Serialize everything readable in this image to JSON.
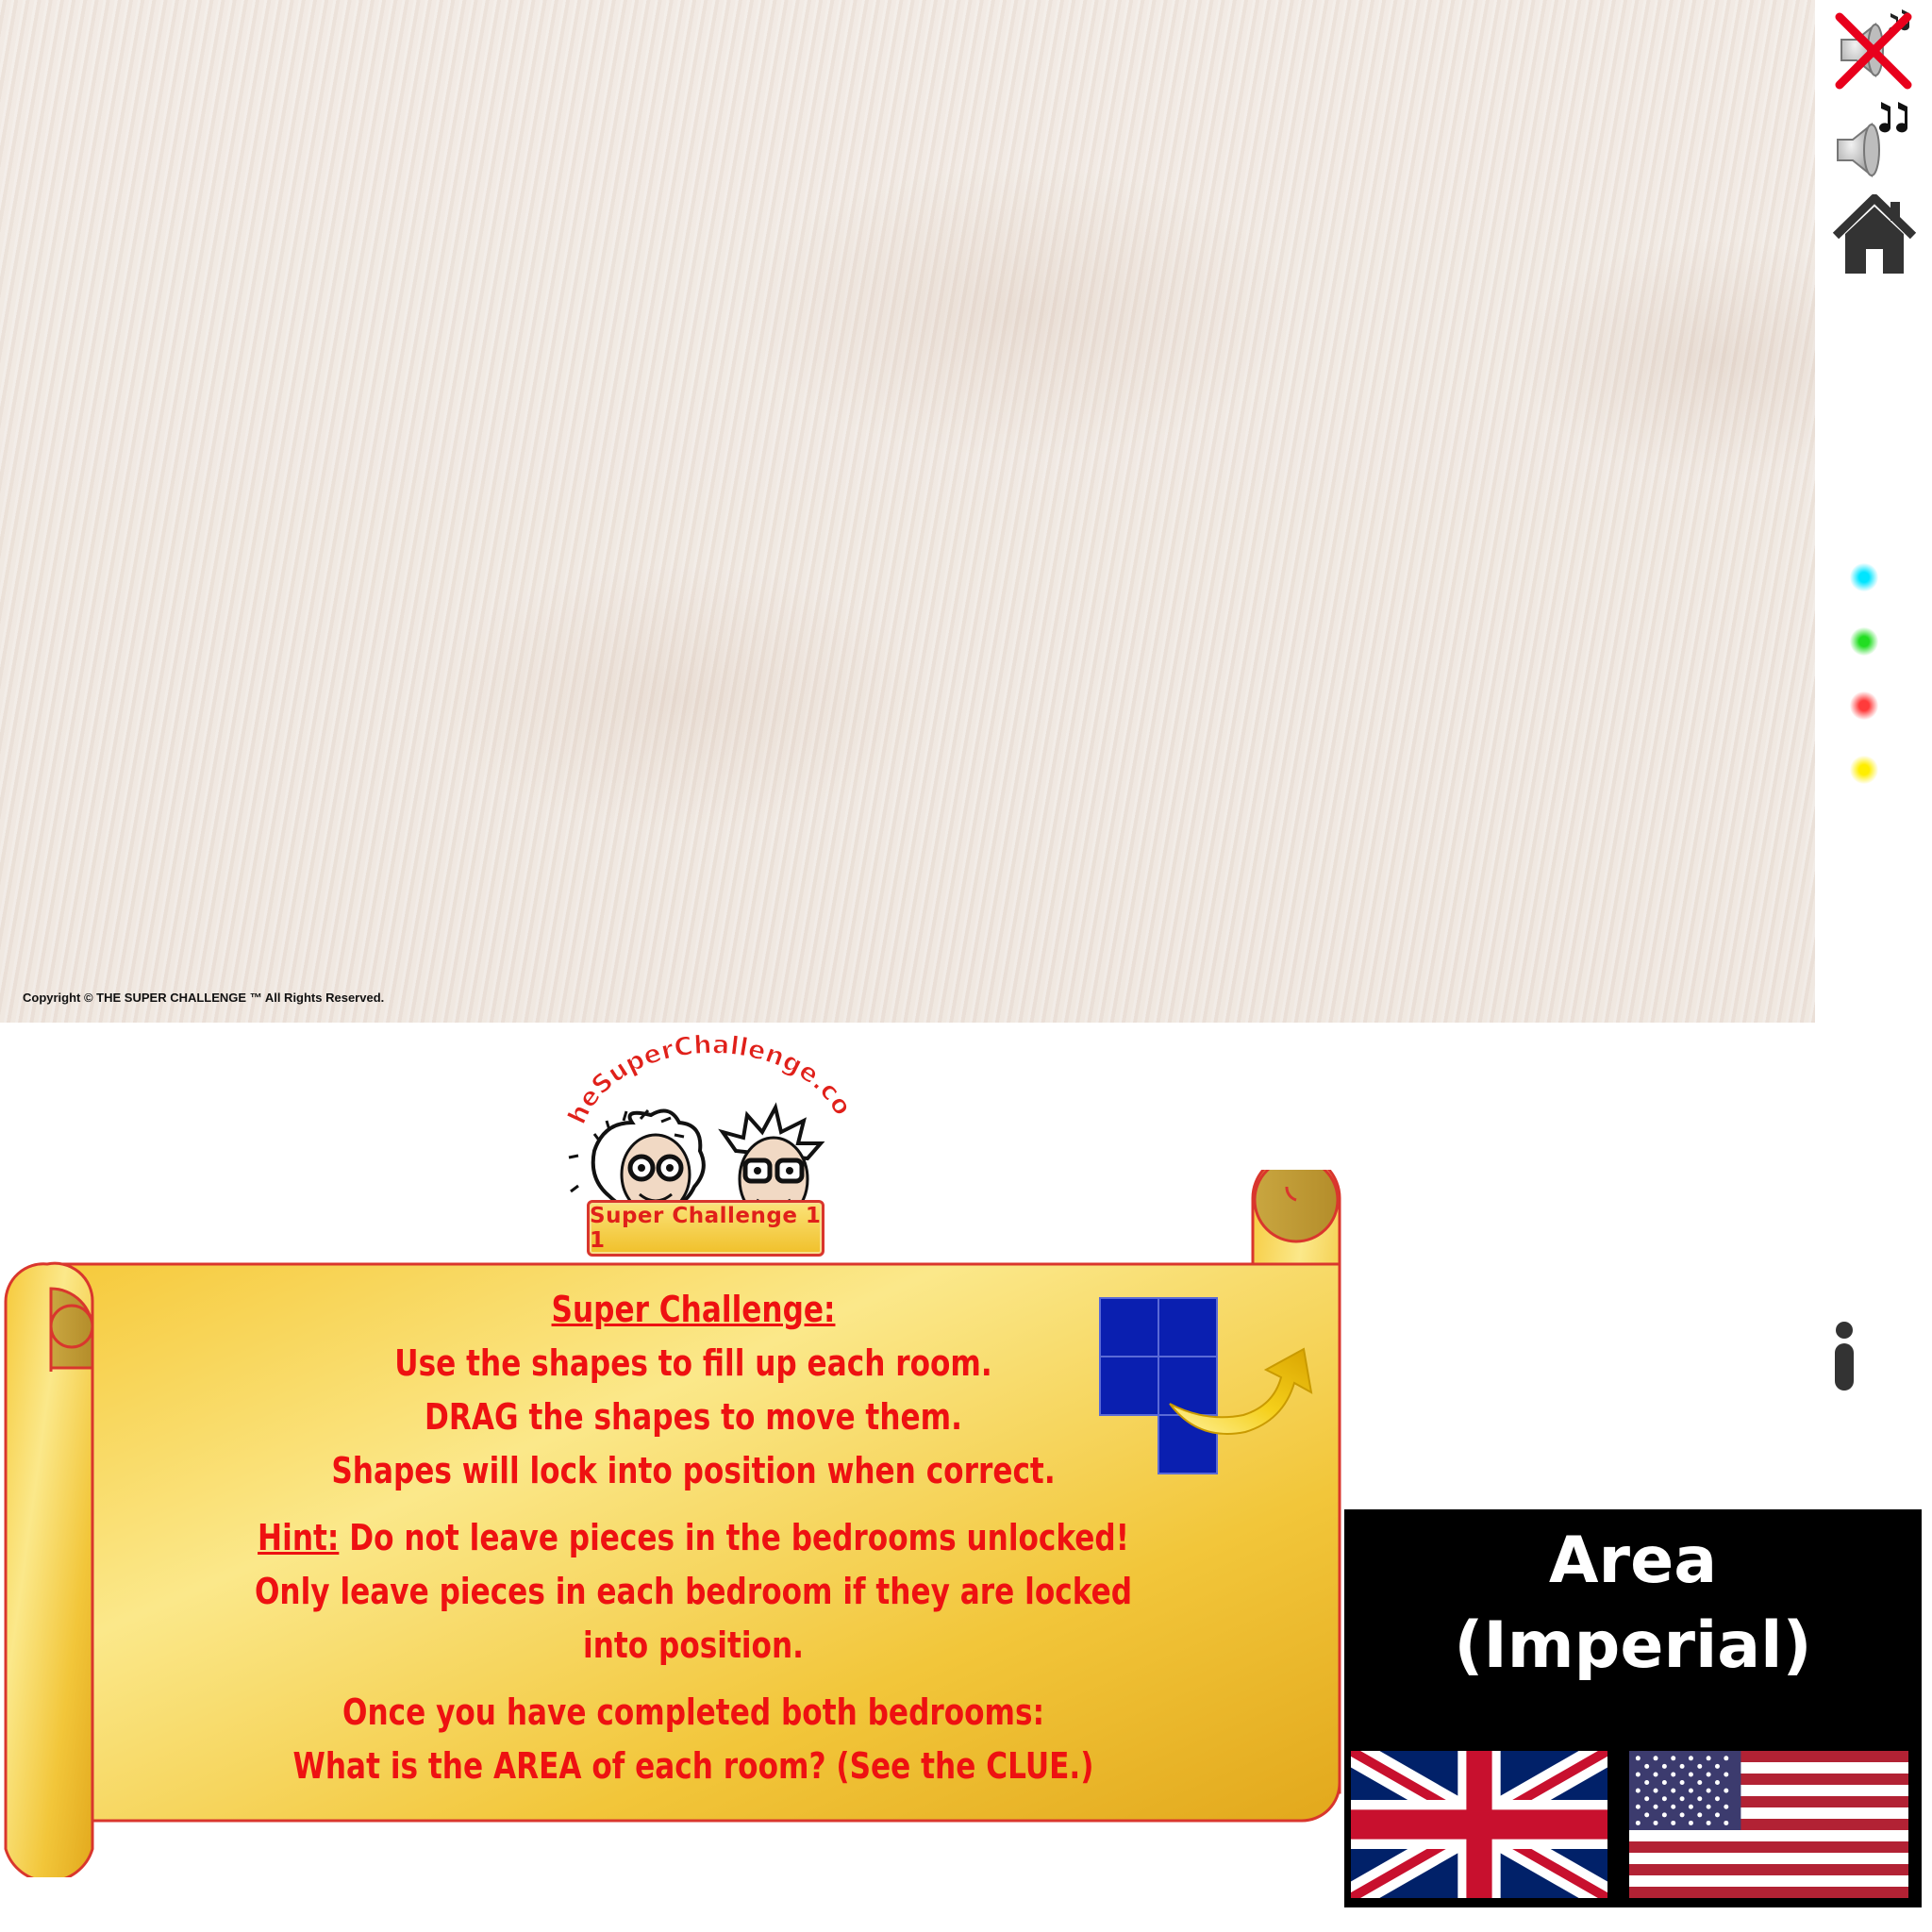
{
  "play_area": {
    "copyright": "Copyright © THE SUPER CHALLENGE ™ All Rights Reserved."
  },
  "toolbar": {
    "mute_icon": "speaker-muted-icon",
    "sound_icon": "speaker-music-icon",
    "home_icon": "home-icon",
    "color_dots": [
      "#00e5ff",
      "#22dd22",
      "#ff3b3b",
      "#ffee00"
    ],
    "info_icon": "info-icon"
  },
  "logo": {
    "arc_text": "TheSuperChallenge.com",
    "level_label": "Super Challenge 1 1"
  },
  "instructions": {
    "heading": "Super Challenge:",
    "line1": "Use the shapes to fill up each room.",
    "line2": "DRAG the shapes to move them.",
    "line3": "Shapes will lock into position when correct.",
    "hint_label": "Hint:",
    "hint_text": " Do not leave pieces in the bedrooms unlocked!",
    "line5": "Only leave pieces in each bedroom if they are locked into position.",
    "line6": "Once you have completed both bedrooms:",
    "line7": "What is the AREA of each room? (See the CLUE.)"
  },
  "shape_diagram": {
    "shape_color": "#0a1fb0",
    "arrow_color": "#f2c200"
  },
  "area_panel": {
    "title_line1": "Area",
    "title_line2": "(Imperial)",
    "flags": [
      "uk-flag",
      "us-flag"
    ]
  }
}
